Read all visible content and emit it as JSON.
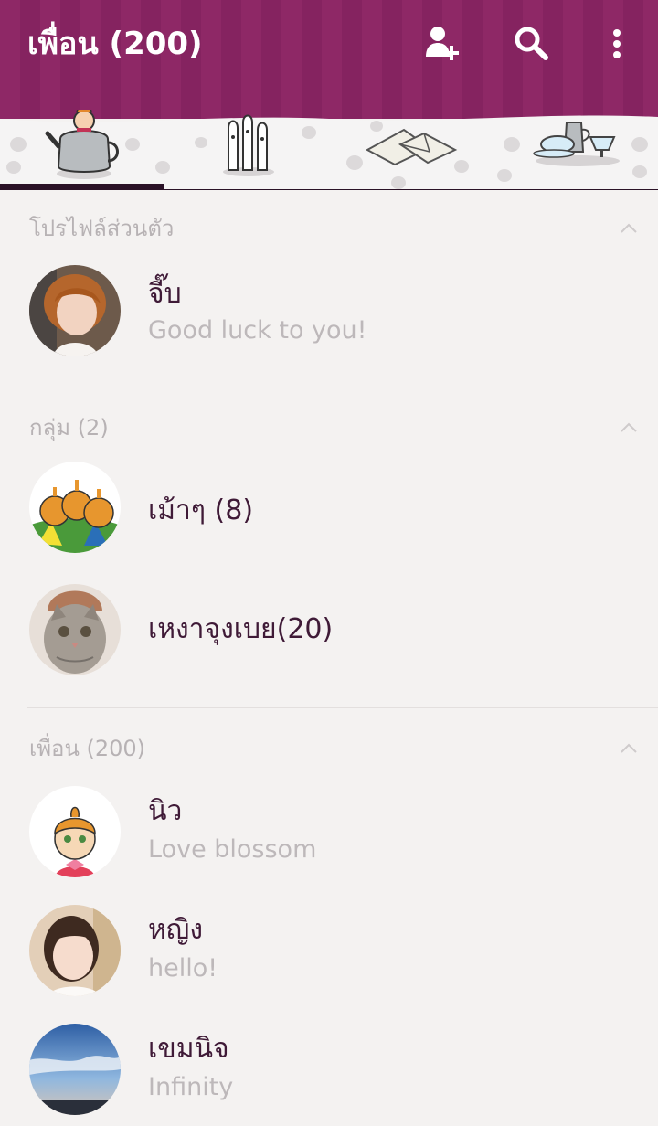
{
  "header": {
    "title": "เพื่อน (200)",
    "actions": [
      {
        "icon": "add-friend-icon"
      },
      {
        "icon": "search-icon"
      },
      {
        "icon": "more-vertical-icon"
      }
    ]
  },
  "tabs": [
    {
      "icon": "kettle-character-icon",
      "active": true
    },
    {
      "icon": "hattifattener-icon",
      "active": false
    },
    {
      "icon": "envelopes-icon",
      "active": false
    },
    {
      "icon": "teapot-cups-icon",
      "active": false
    }
  ],
  "sections": {
    "profile": {
      "title": "โปรไฟล์ส่วนตัว",
      "items": [
        {
          "name": "จี๊บ",
          "status": "Good luck to you!",
          "avatar": "woman-photo-avatar"
        }
      ]
    },
    "groups": {
      "title": "กลุ่ม (2)",
      "items": [
        {
          "name": "เม้าๆ (8)",
          "avatar": "little-my-group-avatar"
        },
        {
          "name": "เหงาจุงเบย(20)",
          "avatar": "cat-photo-avatar"
        }
      ]
    },
    "friends": {
      "title": "เพื่อน (200)",
      "items": [
        {
          "name": "นิว",
          "status": "Love blossom",
          "avatar": "little-my-avatar"
        },
        {
          "name": "หญิง",
          "status": "hello!",
          "avatar": "woman-smiling-avatar"
        },
        {
          "name": "เขมนิจ",
          "status": "Infinity",
          "avatar": "sky-photo-avatar"
        }
      ]
    }
  },
  "colors": {
    "header": "#8e2866",
    "header_stripe": "#852360",
    "background": "#f4f2f1",
    "name_text": "#3f1a37",
    "muted_text": "#b7b2b4",
    "tab_indicator": "#2b1227"
  }
}
